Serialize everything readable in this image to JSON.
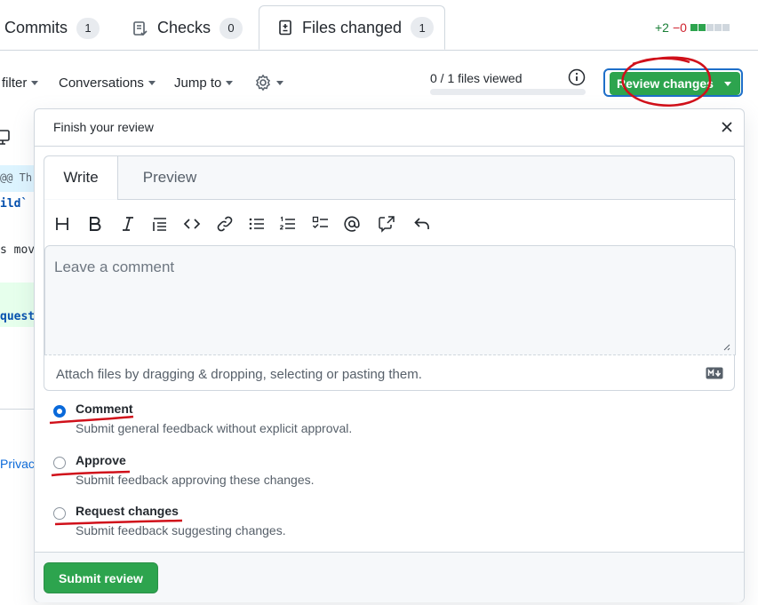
{
  "tabs": [
    {
      "label": "Commits",
      "count": "1"
    },
    {
      "label": "Checks",
      "count": "0"
    },
    {
      "label": "Files changed",
      "count": "1"
    }
  ],
  "diffstat": {
    "additions": "+2",
    "deletions": "−0"
  },
  "toolbar": {
    "filter_label": "filter",
    "conversations_label": "Conversations",
    "jump_label": "Jump to",
    "viewed_text": "0 / 1 files viewed",
    "viewed_progress": 0,
    "review_button_label": "Review changes"
  },
  "background": {
    "hunk_fragment": "@@ Th",
    "code1": "ild`",
    "code2": "s mov",
    "code3": "quest",
    "privacy": "Privac"
  },
  "popover": {
    "title": "Finish your review",
    "tabs": {
      "write": "Write",
      "preview": "Preview"
    },
    "placeholder": "Leave a comment",
    "attach_text": "Attach files by dragging & dropping, selecting or pasting them.",
    "options": [
      {
        "label": "Comment",
        "desc": "Submit general feedback without explicit approval.",
        "checked": true
      },
      {
        "label": "Approve",
        "desc": "Submit feedback approving these changes.",
        "checked": false
      },
      {
        "label": "Request changes",
        "desc": "Submit feedback suggesting changes.",
        "checked": false
      }
    ],
    "submit_label": "Submit review"
  },
  "colors": {
    "accent_green": "#2da44e",
    "focus_blue": "#1e6fc9",
    "annotation_red": "#d0101a"
  }
}
